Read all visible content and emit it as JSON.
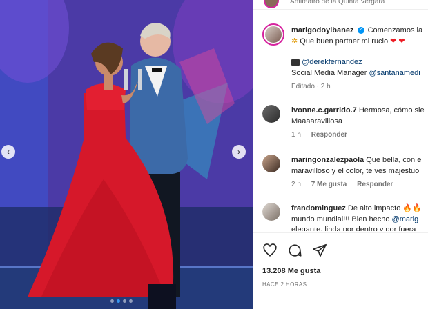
{
  "header": {
    "location": "Anfiteatro de la Quinta Vergara"
  },
  "caption": {
    "username": "marigodoyibanez",
    "line1": "Comenzamos la",
    "line2": "Que buen partner mi rucio",
    "hearts": "❤ ❤",
    "mention_line": "@derekfernandez",
    "role_text": "Social Media Manager",
    "role_mention": "@santanamedi",
    "edited": "Editado · 2 h"
  },
  "comments": [
    {
      "username": "ivonne.c.garrido.7",
      "text1": "Hermosa, cómo sie",
      "text2": "Maaaaravillosa",
      "time": "1 h",
      "likes": "",
      "reply": "Responder"
    },
    {
      "username": "maringonzalezpaola",
      "text1": "Que bella, con e",
      "text2": "maravilloso y el color, te ves majestuo",
      "time": "2 h",
      "likes": "7 Me gusta",
      "reply": "Responder"
    },
    {
      "username": "frandominguez",
      "text1": "De alto impacto",
      "fire": "🔥🔥",
      "text2": "mundo mundial!!! Bien hecho",
      "text2_mention": "@marig",
      "text3": "elegante, linda por dentro y por fuera"
    }
  ],
  "actions": {
    "likes": "13.208 Me gusta",
    "posted": "HACE 2 HORAS"
  },
  "media": {
    "dots_total": 4,
    "dots_active_index": 1
  },
  "icons": {
    "like": "heart-outline-icon",
    "comment": "comment-bubble-icon",
    "share": "paper-plane-icon",
    "prev": "chevron-left-icon",
    "next": "chevron-right-icon"
  },
  "colors": {
    "accent_link": "#00376b",
    "verified": "#0095f6",
    "story_ring": "#d6249f"
  }
}
